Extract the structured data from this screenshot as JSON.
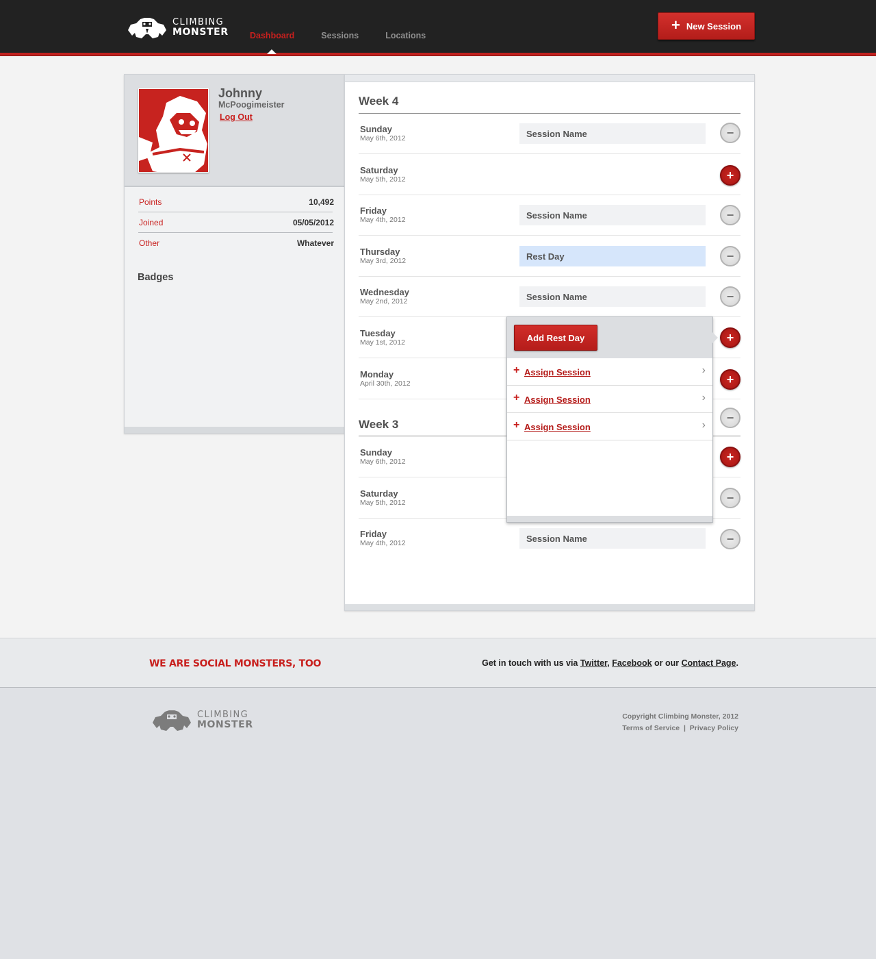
{
  "header": {
    "logo_line1": "CLIMBING",
    "logo_line2": "MONSTER",
    "nav": [
      {
        "label": "Dashboard",
        "active": true
      },
      {
        "label": "Sessions",
        "active": false
      },
      {
        "label": "Locations",
        "active": false
      }
    ],
    "new_session_label": "New Session"
  },
  "profile": {
    "first_name": "Johnny",
    "last_name": "McPoogimeister",
    "logout_label": "Log Out",
    "stats": [
      {
        "key": "Points",
        "value": "10,492"
      },
      {
        "key": "Joined",
        "value": "05/05/2012"
      },
      {
        "key": "Other",
        "value": "Whatever"
      }
    ],
    "badges_title": "Badges"
  },
  "schedule": {
    "week4": {
      "title": "Week 4",
      "days": [
        {
          "name": "Sunday",
          "date": "May 6th, 2012",
          "session": "Session Name",
          "button": "minus"
        },
        {
          "name": "Saturday",
          "date": "May 5th, 2012",
          "session": "",
          "button": "plus"
        },
        {
          "name": "Friday",
          "date": "May 4th, 2012",
          "session": "Session Name",
          "button": "minus"
        },
        {
          "name": "Thursday",
          "date": "May 3rd, 2012",
          "session": "Rest Day",
          "button": "minus"
        },
        {
          "name": "Wednesday",
          "date": "May 2nd, 2012",
          "session": "Session Name",
          "button": "minus"
        },
        {
          "name": "Tuesday",
          "date": "May 1st, 2012",
          "session": "",
          "button": "plus"
        },
        {
          "name": "Monday",
          "date": "April 30th, 2012",
          "session": "",
          "button": "plus"
        }
      ]
    },
    "week3": {
      "title": "Week 3",
      "days": [
        {
          "name": "Sunday",
          "date": "May 6th, 2012",
          "session": "",
          "button": "plus"
        },
        {
          "name": "Saturday",
          "date": "May 5th, 2012",
          "session": "",
          "button": "minus"
        },
        {
          "name": "Friday",
          "date": "May 4th, 2012",
          "session": "Session Name",
          "button": "minus"
        }
      ]
    }
  },
  "popover": {
    "add_rest_label": "Add Rest Day",
    "items": [
      "Assign Session",
      "Assign Session",
      "Assign Session"
    ]
  },
  "footer": {
    "social_title": "WE ARE SOCIAL MONSTERS, TOO",
    "contact_prefix": "Get in touch with us via",
    "twitter": "Twitter",
    "facebook": "Facebook",
    "contact_mid": "or our",
    "contact_page": "Contact Page",
    "copyright": "Copyright Climbing Monster, 2012",
    "terms": "Terms of Service",
    "separator": "|",
    "privacy": "Privacy Policy"
  },
  "colors": {
    "brand_red": "#c8201e",
    "header_bg": "#222222",
    "rest_day_bg": "#d6e6fb"
  }
}
